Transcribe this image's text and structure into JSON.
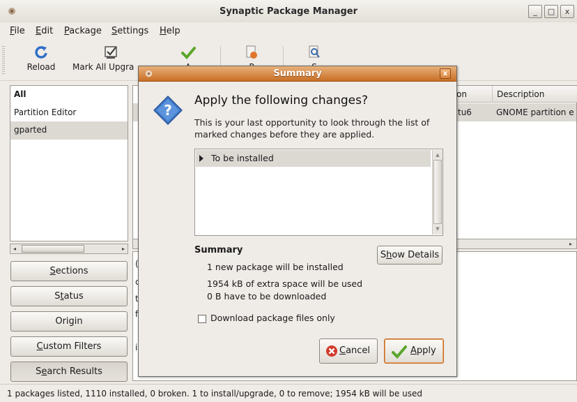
{
  "window": {
    "title": "Synaptic Package Manager"
  },
  "window_controls": {
    "minimize": "_",
    "maximize": "□",
    "close": "x"
  },
  "menubar": [
    {
      "label": "File",
      "accel": "F",
      "rest": "ile"
    },
    {
      "label": "Edit",
      "accel": "E",
      "rest": "dit"
    },
    {
      "label": "Package",
      "accel": "P",
      "rest": "ackage"
    },
    {
      "label": "Settings",
      "accel": "S",
      "rest": "ettings"
    },
    {
      "label": "Help",
      "accel": "H",
      "rest": "elp"
    }
  ],
  "toolbar": {
    "reload": "Reload",
    "mark_all": "Mark All Upgra",
    "apply": "A",
    "properties": "P",
    "search": "S"
  },
  "filter_list": [
    "All",
    "Partition Editor",
    "gparted"
  ],
  "side_buttons": [
    {
      "accel": "S",
      "rest": "ections"
    },
    {
      "pre": "S",
      "accel": "t",
      "rest": "atus"
    },
    {
      "label": "Origin"
    },
    {
      "accel": "C",
      "rest": "ustom Filters"
    },
    {
      "pre": "S",
      "accel": "e",
      "rest": "arch Results"
    }
  ],
  "package_list": {
    "columns": [
      "on",
      "Description"
    ],
    "row": {
      "version_tail": "tu6",
      "description": "GNOME partition e"
    }
  },
  "desc_fragments": [
    "(",
    "c",
    "t",
    "f",
    "i"
  ],
  "status_bar": "1 packages listed, 1110 installed, 0 broken. 1 to install/upgrade, 0 to remove; 1954 kB will be used",
  "dialog": {
    "title": "Summary",
    "close": "x",
    "heading": "Apply the following changes?",
    "body": "This is your last opportunity to look through the list of marked changes before they are applied.",
    "changes": [
      "To be installed"
    ],
    "summary_title": "Summary",
    "summary_lines": [
      "1 new package will be installed",
      "1954 kB of extra space will be used",
      "0  B have to be downloaded"
    ],
    "show_details": {
      "pre": "S",
      "accel": "h",
      "rest": "ow Details"
    },
    "download_only": "Download package files only",
    "cancel": {
      "accel": "C",
      "rest": "ancel"
    },
    "apply": {
      "accel": "A",
      "rest": "pply"
    }
  }
}
